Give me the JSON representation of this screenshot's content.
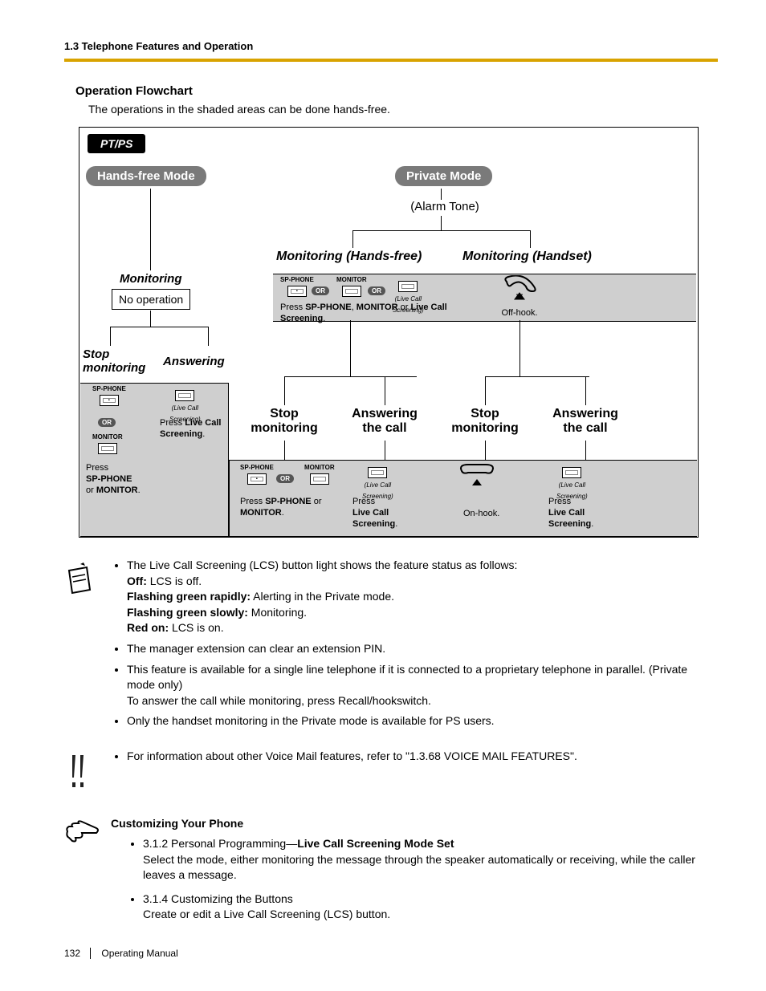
{
  "header": {
    "section": "1.3 Telephone Features and Operation"
  },
  "title": "Operation Flowchart",
  "intro": "The operations in the shaded areas can be done hands-free.",
  "flow": {
    "tag": "PT/PS",
    "handsfree_mode": "Hands-free Mode",
    "private_mode": "Private Mode",
    "alarm": "(Alarm Tone)",
    "mon_hf": "Monitoring (Hands-free)",
    "mon_hs": "Monitoring (Handset)",
    "monitoring": "Monitoring",
    "no_op": "No operation",
    "stop_mon": "Stop\nmonitoring",
    "answering": "Answering",
    "answering_call": "Answering\nthe call",
    "sp_phone": "SP-PHONE",
    "monitor": "MONITOR",
    "or": "OR",
    "lcs": "(Live Call\nScreening)",
    "press_lcs": "Press Live Call\nScreening.",
    "press_spm": "Press SP-PHONE\nor MONITOR.",
    "press_spm_or": "Press SP-PHONE or\nMONITOR.",
    "press_lcs_short": "Press\nLive Call\nScreening.",
    "press_three": "Press SP-PHONE, MONITOR or Live Call\nScreening.",
    "offhook": "Off-hook.",
    "onhook": "On-hook."
  },
  "notes": {
    "b1_intro": "The Live Call Screening (LCS) button light shows the feature status as follows:",
    "b1_off_label": "Off:",
    "b1_off": " LCS is off.",
    "b1_fgr_label": "Flashing green rapidly:",
    "b1_fgr": " Alerting in the Private mode.",
    "b1_fgs_label": "Flashing green slowly:",
    "b1_fgs": " Monitoring.",
    "b1_red_label": "Red on:",
    "b1_red": " LCS is on.",
    "b2": "The manager extension can clear an extension PIN.",
    "b3a": "This feature is available for a single line telephone if it is connected to a proprietary telephone in parallel. (Private mode only)",
    "b3b": "To answer the call while monitoring, press Recall/hookswitch.",
    "b4": "Only the handset monitoring in the Private mode is available for PS users."
  },
  "info_bullet": "For information about other Voice Mail features, refer to \"1.3.68 VOICE MAIL FEATURES\".",
  "customize": {
    "title": "Customizing Your Phone",
    "i1_prefix": "3.1.2 Personal Programming—",
    "i1_bold": "Live Call Screening Mode Set",
    "i1_desc": "Select the mode, either monitoring the message through the speaker automatically or receiving, while the caller leaves a message.",
    "i2_title": "3.1.4 Customizing the Buttons",
    "i2_desc": "Create or edit a Live Call Screening (LCS) button."
  },
  "footer": {
    "page": "132",
    "manual": "Operating Manual"
  }
}
